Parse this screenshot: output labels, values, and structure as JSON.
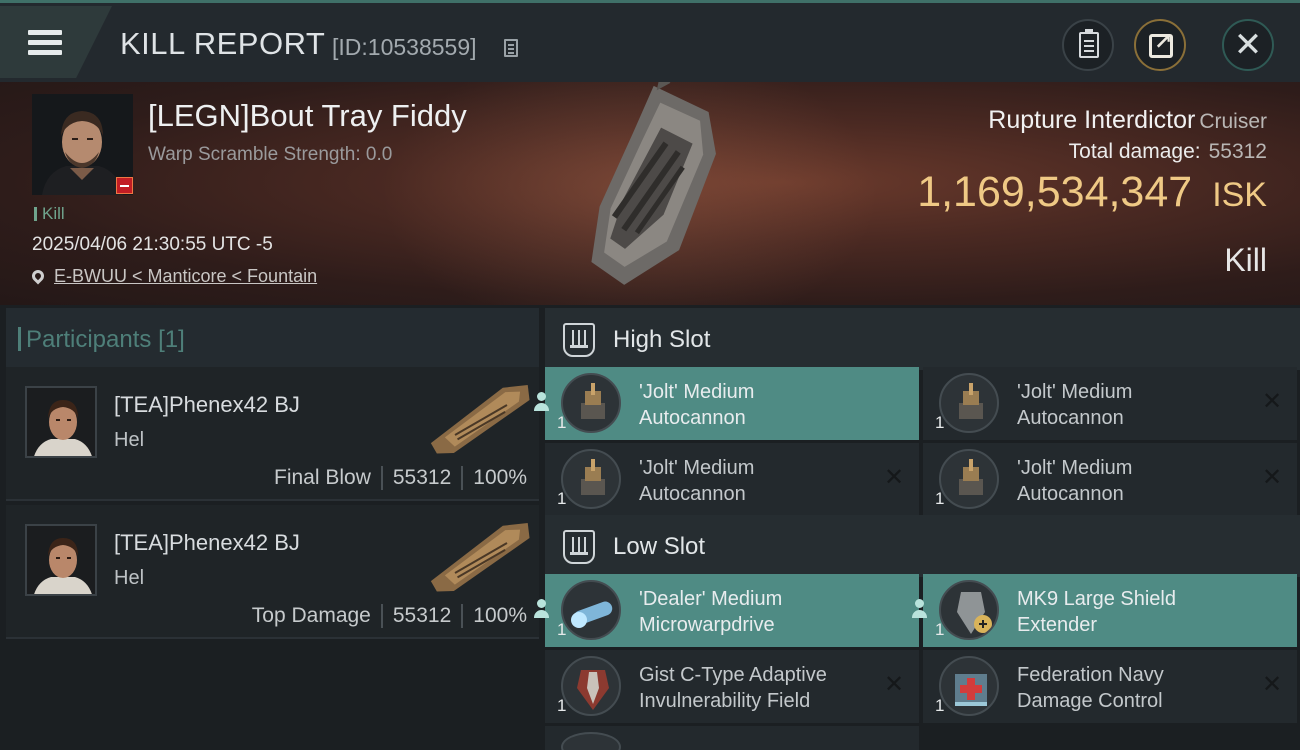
{
  "header": {
    "title": "KILL REPORT",
    "report_id": "[ID:10538559]"
  },
  "victim": {
    "name": "[LEGN]Bout Tray Fiddy",
    "scramble_strength": "Warp Scramble Strength: 0.0",
    "tag": "Kill",
    "timestamp": "2025/04/06 21:30:55 UTC -5",
    "location": "E-BWUU < Manticore < Fountain",
    "ship_name": "Rupture Interdictor",
    "ship_class": "Cruiser",
    "total_damage_label": "Total damage:",
    "total_damage": "55312",
    "isk_value": "1,169,534,347",
    "isk_unit": "ISK",
    "result": "Kill"
  },
  "participants": {
    "title": "Participants",
    "count": "[1]",
    "items": [
      {
        "name": "[TEA]Phenex42 BJ",
        "corp": "Hel",
        "role": "Final Blow",
        "damage": "55312",
        "percent": "100%"
      },
      {
        "name": "[TEA]Phenex42 BJ",
        "corp": "Hel",
        "role": "Top Damage",
        "damage": "55312",
        "percent": "100%"
      }
    ]
  },
  "fitting": {
    "high_slot": {
      "title": "High Slot",
      "modules": [
        {
          "qty": "1",
          "name_line1": "'Jolt' Medium",
          "name_line2": "Autocannon",
          "status": "dropped"
        },
        {
          "qty": "1",
          "name_line1": "'Jolt' Medium",
          "name_line2": "Autocannon",
          "status": "destroyed"
        },
        {
          "qty": "1",
          "name_line1": "'Jolt' Medium",
          "name_line2": "Autocannon",
          "status": "destroyed"
        },
        {
          "qty": "1",
          "name_line1": "'Jolt' Medium",
          "name_line2": "Autocannon",
          "status": "destroyed"
        }
      ]
    },
    "low_slot": {
      "title": "Low Slot",
      "modules": [
        {
          "qty": "1",
          "name_line1": "'Dealer' Medium",
          "name_line2": "Microwarpdrive",
          "status": "dropped"
        },
        {
          "qty": "1",
          "name_line1": "MK9 Large Shield",
          "name_line2": "Extender",
          "status": "dropped"
        },
        {
          "qty": "1",
          "name_line1": "Gist C-Type Adaptive",
          "name_line2": "Invulnerability Field",
          "status": "destroyed"
        },
        {
          "qty": "1",
          "name_line1": "Federation Navy",
          "name_line2": "Damage Control",
          "status": "destroyed"
        }
      ]
    }
  },
  "colors": {
    "accent_teal": "#4f8b84",
    "isk_gold": "#efc985",
    "kill_green": "#6fa48d",
    "loss_red": "#c21d24"
  },
  "icons": {
    "menu": "hamburger-menu-icon",
    "copy": "copy-icon",
    "clipboard": "clipboard-icon",
    "share": "share-icon",
    "close": "close-icon",
    "location": "location-pin-icon",
    "slot": "slot-icon",
    "dropped": "person-icon",
    "destroyed": "x-icon"
  }
}
